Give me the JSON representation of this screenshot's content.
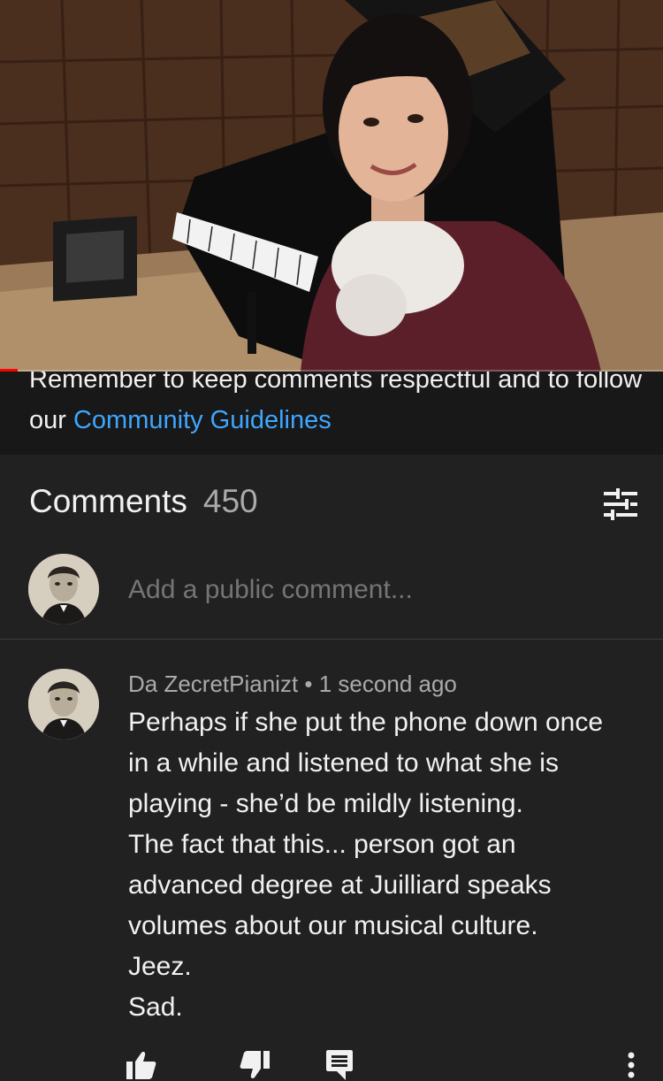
{
  "video": {
    "progress": 0.027
  },
  "guidelines": {
    "text": "Remember to keep comments respectful and to follow our ",
    "link": "Community Guidelines"
  },
  "comments": {
    "title": "Comments",
    "count": "450",
    "sort_icon": "sort-filter-icon",
    "add_placeholder": "Add a public comment...",
    "items": [
      {
        "author": "Da ZecretPianizt",
        "time": "1 second ago",
        "lines": [
          "Perhaps if she put the phone down once",
          "in a while and listened to what she is",
          "playing - she’d be mildly listening.",
          "The fact that this... person got an",
          "advanced degree at Juilliard speaks",
          "volumes about our musical culture.",
          "Jeez.",
          "Sad."
        ]
      }
    ]
  },
  "icons": {
    "like": "thumb-up-icon",
    "dislike": "thumb-down-icon",
    "reply": "reply-icon",
    "more": "more-vert-icon"
  },
  "colors": {
    "accent": "#3ea6ff",
    "progress": "#ff0000",
    "background": "#212121"
  }
}
